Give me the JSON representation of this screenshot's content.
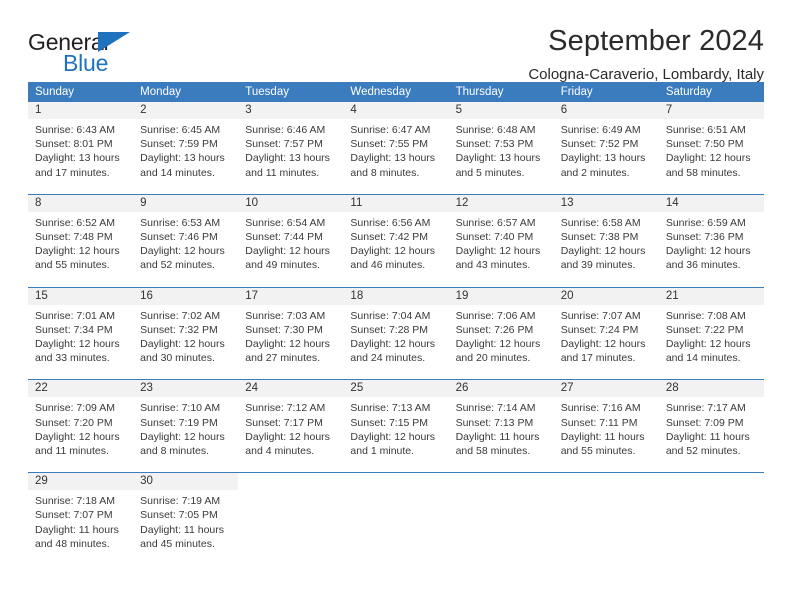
{
  "brand": {
    "name_part1": "General",
    "name_part2": "Blue",
    "flag_icon": "blue-triangle-flag",
    "accent_color": "#1f72bd"
  },
  "header": {
    "title": "September 2024",
    "subtitle": "Cologna-Caraverio, Lombardy, Italy"
  },
  "calendar": {
    "header_color": "#3b7cbe",
    "daynum_bg": "#f2f2f2",
    "weekdays": [
      "Sunday",
      "Monday",
      "Tuesday",
      "Wednesday",
      "Thursday",
      "Friday",
      "Saturday"
    ],
    "weeks": [
      [
        {
          "day": "1",
          "sunrise": "Sunrise: 6:43 AM",
          "sunset": "Sunset: 8:01 PM",
          "daylight_1": "Daylight: 13 hours",
          "daylight_2": "and 17 minutes."
        },
        {
          "day": "2",
          "sunrise": "Sunrise: 6:45 AM",
          "sunset": "Sunset: 7:59 PM",
          "daylight_1": "Daylight: 13 hours",
          "daylight_2": "and 14 minutes."
        },
        {
          "day": "3",
          "sunrise": "Sunrise: 6:46 AM",
          "sunset": "Sunset: 7:57 PM",
          "daylight_1": "Daylight: 13 hours",
          "daylight_2": "and 11 minutes."
        },
        {
          "day": "4",
          "sunrise": "Sunrise: 6:47 AM",
          "sunset": "Sunset: 7:55 PM",
          "daylight_1": "Daylight: 13 hours",
          "daylight_2": "and 8 minutes."
        },
        {
          "day": "5",
          "sunrise": "Sunrise: 6:48 AM",
          "sunset": "Sunset: 7:53 PM",
          "daylight_1": "Daylight: 13 hours",
          "daylight_2": "and 5 minutes."
        },
        {
          "day": "6",
          "sunrise": "Sunrise: 6:49 AM",
          "sunset": "Sunset: 7:52 PM",
          "daylight_1": "Daylight: 13 hours",
          "daylight_2": "and 2 minutes."
        },
        {
          "day": "7",
          "sunrise": "Sunrise: 6:51 AM",
          "sunset": "Sunset: 7:50 PM",
          "daylight_1": "Daylight: 12 hours",
          "daylight_2": "and 58 minutes."
        }
      ],
      [
        {
          "day": "8",
          "sunrise": "Sunrise: 6:52 AM",
          "sunset": "Sunset: 7:48 PM",
          "daylight_1": "Daylight: 12 hours",
          "daylight_2": "and 55 minutes."
        },
        {
          "day": "9",
          "sunrise": "Sunrise: 6:53 AM",
          "sunset": "Sunset: 7:46 PM",
          "daylight_1": "Daylight: 12 hours",
          "daylight_2": "and 52 minutes."
        },
        {
          "day": "10",
          "sunrise": "Sunrise: 6:54 AM",
          "sunset": "Sunset: 7:44 PM",
          "daylight_1": "Daylight: 12 hours",
          "daylight_2": "and 49 minutes."
        },
        {
          "day": "11",
          "sunrise": "Sunrise: 6:56 AM",
          "sunset": "Sunset: 7:42 PM",
          "daylight_1": "Daylight: 12 hours",
          "daylight_2": "and 46 minutes."
        },
        {
          "day": "12",
          "sunrise": "Sunrise: 6:57 AM",
          "sunset": "Sunset: 7:40 PM",
          "daylight_1": "Daylight: 12 hours",
          "daylight_2": "and 43 minutes."
        },
        {
          "day": "13",
          "sunrise": "Sunrise: 6:58 AM",
          "sunset": "Sunset: 7:38 PM",
          "daylight_1": "Daylight: 12 hours",
          "daylight_2": "and 39 minutes."
        },
        {
          "day": "14",
          "sunrise": "Sunrise: 6:59 AM",
          "sunset": "Sunset: 7:36 PM",
          "daylight_1": "Daylight: 12 hours",
          "daylight_2": "and 36 minutes."
        }
      ],
      [
        {
          "day": "15",
          "sunrise": "Sunrise: 7:01 AM",
          "sunset": "Sunset: 7:34 PM",
          "daylight_1": "Daylight: 12 hours",
          "daylight_2": "and 33 minutes."
        },
        {
          "day": "16",
          "sunrise": "Sunrise: 7:02 AM",
          "sunset": "Sunset: 7:32 PM",
          "daylight_1": "Daylight: 12 hours",
          "daylight_2": "and 30 minutes."
        },
        {
          "day": "17",
          "sunrise": "Sunrise: 7:03 AM",
          "sunset": "Sunset: 7:30 PM",
          "daylight_1": "Daylight: 12 hours",
          "daylight_2": "and 27 minutes."
        },
        {
          "day": "18",
          "sunrise": "Sunrise: 7:04 AM",
          "sunset": "Sunset: 7:28 PM",
          "daylight_1": "Daylight: 12 hours",
          "daylight_2": "and 24 minutes."
        },
        {
          "day": "19",
          "sunrise": "Sunrise: 7:06 AM",
          "sunset": "Sunset: 7:26 PM",
          "daylight_1": "Daylight: 12 hours",
          "daylight_2": "and 20 minutes."
        },
        {
          "day": "20",
          "sunrise": "Sunrise: 7:07 AM",
          "sunset": "Sunset: 7:24 PM",
          "daylight_1": "Daylight: 12 hours",
          "daylight_2": "and 17 minutes."
        },
        {
          "day": "21",
          "sunrise": "Sunrise: 7:08 AM",
          "sunset": "Sunset: 7:22 PM",
          "daylight_1": "Daylight: 12 hours",
          "daylight_2": "and 14 minutes."
        }
      ],
      [
        {
          "day": "22",
          "sunrise": "Sunrise: 7:09 AM",
          "sunset": "Sunset: 7:20 PM",
          "daylight_1": "Daylight: 12 hours",
          "daylight_2": "and 11 minutes."
        },
        {
          "day": "23",
          "sunrise": "Sunrise: 7:10 AM",
          "sunset": "Sunset: 7:19 PM",
          "daylight_1": "Daylight: 12 hours",
          "daylight_2": "and 8 minutes."
        },
        {
          "day": "24",
          "sunrise": "Sunrise: 7:12 AM",
          "sunset": "Sunset: 7:17 PM",
          "daylight_1": "Daylight: 12 hours",
          "daylight_2": "and 4 minutes."
        },
        {
          "day": "25",
          "sunrise": "Sunrise: 7:13 AM",
          "sunset": "Sunset: 7:15 PM",
          "daylight_1": "Daylight: 12 hours",
          "daylight_2": "and 1 minute."
        },
        {
          "day": "26",
          "sunrise": "Sunrise: 7:14 AM",
          "sunset": "Sunset: 7:13 PM",
          "daylight_1": "Daylight: 11 hours",
          "daylight_2": "and 58 minutes."
        },
        {
          "day": "27",
          "sunrise": "Sunrise: 7:16 AM",
          "sunset": "Sunset: 7:11 PM",
          "daylight_1": "Daylight: 11 hours",
          "daylight_2": "and 55 minutes."
        },
        {
          "day": "28",
          "sunrise": "Sunrise: 7:17 AM",
          "sunset": "Sunset: 7:09 PM",
          "daylight_1": "Daylight: 11 hours",
          "daylight_2": "and 52 minutes."
        }
      ],
      [
        {
          "day": "29",
          "sunrise": "Sunrise: 7:18 AM",
          "sunset": "Sunset: 7:07 PM",
          "daylight_1": "Daylight: 11 hours",
          "daylight_2": "and 48 minutes."
        },
        {
          "day": "30",
          "sunrise": "Sunrise: 7:19 AM",
          "sunset": "Sunset: 7:05 PM",
          "daylight_1": "Daylight: 11 hours",
          "daylight_2": "and 45 minutes."
        },
        {
          "day": "",
          "sunrise": "",
          "sunset": "",
          "daylight_1": "",
          "daylight_2": ""
        },
        {
          "day": "",
          "sunrise": "",
          "sunset": "",
          "daylight_1": "",
          "daylight_2": ""
        },
        {
          "day": "",
          "sunrise": "",
          "sunset": "",
          "daylight_1": "",
          "daylight_2": ""
        },
        {
          "day": "",
          "sunrise": "",
          "sunset": "",
          "daylight_1": "",
          "daylight_2": ""
        },
        {
          "day": "",
          "sunrise": "",
          "sunset": "",
          "daylight_1": "",
          "daylight_2": ""
        }
      ]
    ]
  }
}
